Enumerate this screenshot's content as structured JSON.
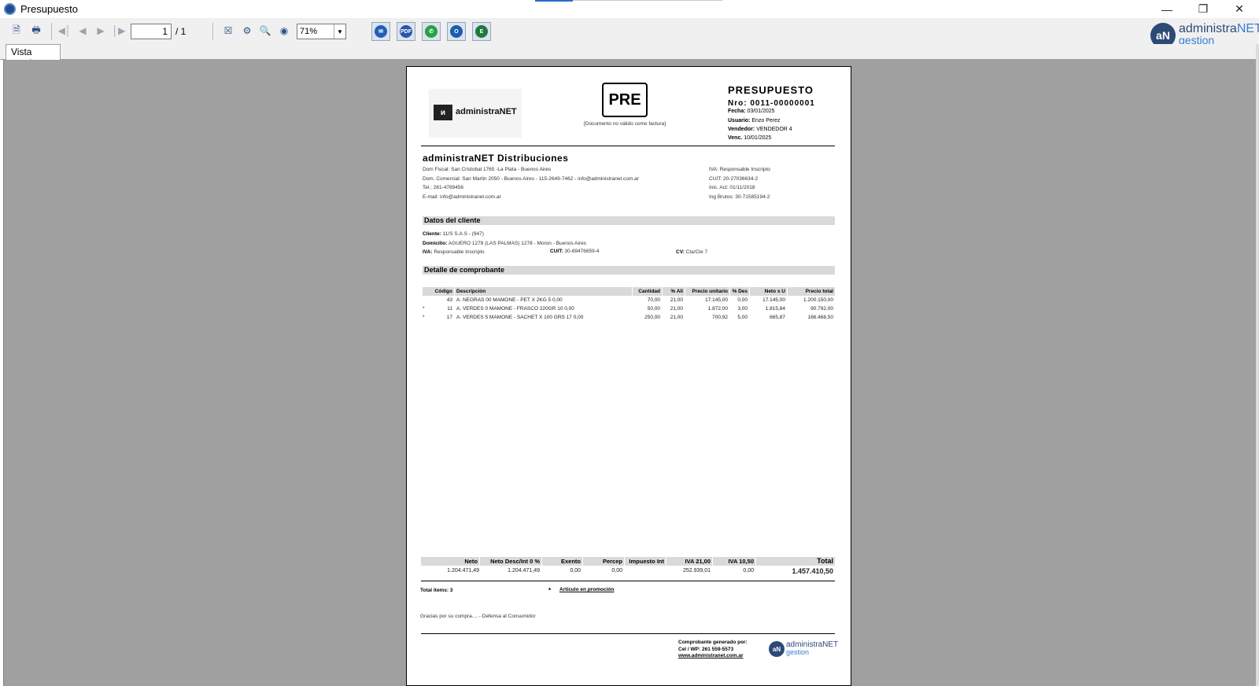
{
  "window": {
    "title": "Presupuesto"
  },
  "toolbar": {
    "page_current": "1",
    "page_total": "/ 1",
    "zoom": "71%",
    "share_buttons": [
      {
        "name": "email",
        "color": "#1f5fb8",
        "glyph": "✉"
      },
      {
        "name": "pdf",
        "color": "#2a55a8",
        "glyph": "PDF"
      },
      {
        "name": "whatsapp",
        "color": "#25a244",
        "glyph": "✆"
      },
      {
        "name": "outlook",
        "color": "#1b5cb0",
        "glyph": "O"
      },
      {
        "name": "excel",
        "color": "#1e7a3a",
        "glyph": "E"
      }
    ]
  },
  "brand": {
    "line1a": "administra",
    "line1b": "NET",
    "line2": "gestion",
    "circle": "aN"
  },
  "tab": {
    "label": "Vista previa"
  },
  "doc": {
    "logo_text": "administraNET",
    "logo_mark": "ᴎ",
    "code": "PRE",
    "code_note": "[Documento no válido como factura]",
    "title": "PRESUPUESTO",
    "nro": "Nro: 0011-00000001",
    "fecha_label": "Fecha:",
    "fecha": "03/01/2025",
    "usuario_label": "Usuario:",
    "usuario": "Enzo Perez",
    "vendedor_label": "Vendedor:",
    "vendedor": "VENDEDOR 4",
    "venc_label": "Venc.",
    "venc": "10/01/2025",
    "company": "administraNET Distribuciones",
    "company_lines": [
      "Dom Fiscal: San Cristobal 1765 -La Plata - Buenos Aires",
      "Dom. Comercial: San Martin 2050 - Buenos Aires - 115-2649-7462 - info@administranet.com.ar",
      "Tel.: 261-4789456",
      "E-mail: info@administranet.com.ar"
    ],
    "company_right": [
      "IVA: Responsable Inscripto",
      "CUIT: 20-27036634-2",
      "Inic. Act: 01/11/2018",
      "Ing Brutos: 30-71585194-2"
    ],
    "client_section": "Datos del cliente",
    "cliente_label": "Cliente:",
    "cliente": "11/S S.A.S - (947)",
    "domicilio_label": "Domicilio:",
    "domicilio": "AGUERO 1278 (LAS PALMAS) 1278 - Moron - Buenos Aires",
    "iva_label": "IVA:",
    "iva": "Responsable Inscripto",
    "cuit_label": "CUIT:",
    "cuit": "30-69476859-4",
    "cv_label": "CV:",
    "cv": "Cta/Cte 7",
    "detail_section": "Detalle de comprobante",
    "columns": [
      "Código",
      "Descripción",
      "Cantidad",
      "% Ali",
      "Precio unitario",
      "% Des",
      "Neto x U",
      "Precio total"
    ],
    "items": [
      {
        "mark": "",
        "codigo": "43",
        "desc": "A. NEGRAS 00 MAMONE - PET X 2KG 5  0,00",
        "cantidad": "70,00",
        "ali": "21,00",
        "unit": "17.145,00",
        "des": "0,00",
        "neto": "17.145,00",
        "total": "1.200.150,00"
      },
      {
        "mark": "*",
        "codigo": "11",
        "desc": "A. VERDES 0  MAMONE - FRASCO 220GR 10  0,00",
        "cantidad": "50,00",
        "ali": "21,00",
        "unit": "1.872,00",
        "des": "3,00",
        "neto": "1.815,84",
        "total": "90.792,00"
      },
      {
        "mark": "*",
        "codigo": "17",
        "desc": "A. VERDES 5  MAMONE - SACHET X 100 GRS 17  0,00",
        "cantidad": "250,00",
        "ali": "21,00",
        "unit": "700,92",
        "des": "5,00",
        "neto": "665,87",
        "total": "166.468,50"
      }
    ],
    "totals_headers": [
      "Neto",
      "Neto Desc/Int 0 %",
      "Exento",
      "Percep",
      "Impuesto Int",
      "IVA 21,00",
      "IVA 10,50",
      "Total"
    ],
    "totals_values": [
      "1.204.471,49",
      "1.204.471,49",
      "0,00",
      "0,00",
      "",
      "252.939,01",
      "0,00",
      "1.457.410,50"
    ],
    "total_items": "Total items: 3",
    "promo_mark": "*",
    "promo_label": "Artículo en promoción",
    "thanks": "Gracias por su compra.... - Defensa al Consumidor",
    "gen_line1": "Comprobante generado por:",
    "gen_line2": "Cel / WP: 261 559-5573",
    "gen_line3": "www.administranet.com.ar",
    "footer_logo_a": "administraNET",
    "footer_logo_b": "gestion"
  }
}
